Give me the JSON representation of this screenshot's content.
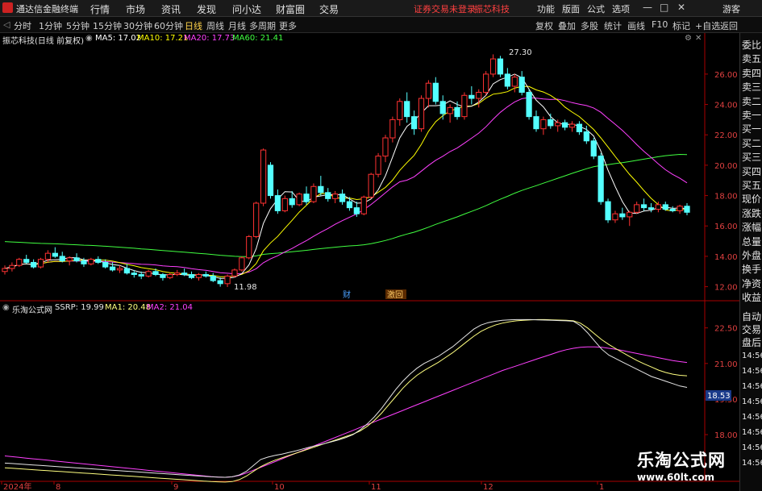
{
  "menubar": {
    "app_title": "通达信金融终端",
    "menus": [
      "行情",
      "市场",
      "资讯",
      "发现",
      "问小达",
      "财富圈",
      "交易"
    ],
    "notice": "证券交易未登录",
    "stock_name": "振芯科技",
    "right_menus": [
      "功能",
      "版面",
      "公式",
      "选项"
    ],
    "user": "游客",
    "controls": [
      "—",
      "□",
      "✕"
    ]
  },
  "toolbar": {
    "periods": [
      "分时",
      "1分钟",
      "5分钟",
      "15分钟",
      "30分钟",
      "60分钟",
      "日线",
      "周线",
      "月线",
      "多周期",
      "更多"
    ],
    "active": "日线",
    "right_items": [
      "复权",
      "叠加",
      "多股",
      "统计",
      "画线",
      "F10",
      "标记",
      "+自选",
      "返回"
    ]
  },
  "main_header": {
    "title": "振芯科技(日线 前复权)",
    "ma5": "MA5: 17.02",
    "ma10": "MA10: 17.21",
    "ma20": "MA20: 17.73",
    "ma60": "MA60: 21.41",
    "colors": {
      "ma5": "#ffffff",
      "ma10": "#ffff00",
      "ma20": "#ff40ff",
      "ma60": "#40ff40"
    }
  },
  "indicator_header": {
    "title": "乐淘公式网",
    "ssrp": "SSRP: 19.99",
    "ma1": "MA1: 20.48",
    "ma2": "MA2: 21.04"
  },
  "price_axis": [
    "26.00",
    "24.00",
    "22.00",
    "20.00",
    "18.00",
    "16.00",
    "14.00",
    "12.00"
  ],
  "indicator_axis": [
    "22.50",
    "21.00",
    "19.50",
    "18.00"
  ],
  "indicator_readout": "18.53",
  "annotations": {
    "high": "27.30",
    "low": "11.98",
    "tag_cai": "财",
    "tag_jihui": "激回"
  },
  "time_axis": [
    "2024年",
    "8",
    "9",
    "10",
    "11",
    "12",
    "1"
  ],
  "right_panel": {
    "top_labels": [
      "委比",
      "卖五",
      "卖四",
      "卖三",
      "卖二",
      "卖一",
      "买一",
      "买二",
      "买三",
      "买四",
      "买五",
      "现价",
      "涨跌",
      "涨幅",
      "总量",
      "外盘",
      "换手",
      "净资",
      "收益"
    ],
    "bottom_labels": [
      "自动",
      "交易",
      "盘后"
    ],
    "times": [
      "14:56",
      "14:56",
      "14:56",
      "14:56",
      "14:56",
      "14:56",
      "14:56",
      "14:56"
    ]
  },
  "watermark": {
    "line1": "乐淘公式网",
    "line2": "www.60lt.com"
  },
  "chart_data": {
    "type": "line",
    "title": "振芯科技(日线 前复权)",
    "ylim": [
      11.5,
      27.8
    ],
    "candles": [
      {
        "o": 13.0,
        "h": 13.4,
        "l": 12.8,
        "c": 13.2
      },
      {
        "o": 13.2,
        "h": 13.6,
        "l": 13.0,
        "c": 13.4
      },
      {
        "o": 13.4,
        "h": 13.9,
        "l": 13.3,
        "c": 13.8
      },
      {
        "o": 13.8,
        "h": 14.1,
        "l": 13.5,
        "c": 13.6
      },
      {
        "o": 13.6,
        "h": 13.8,
        "l": 13.2,
        "c": 13.3
      },
      {
        "o": 13.3,
        "h": 13.9,
        "l": 13.2,
        "c": 13.8
      },
      {
        "o": 13.8,
        "h": 14.4,
        "l": 13.6,
        "c": 14.2
      },
      {
        "o": 14.2,
        "h": 14.6,
        "l": 13.9,
        "c": 14.0
      },
      {
        "o": 14.0,
        "h": 14.3,
        "l": 13.6,
        "c": 13.7
      },
      {
        "o": 13.7,
        "h": 14.0,
        "l": 13.4,
        "c": 13.9
      },
      {
        "o": 13.9,
        "h": 14.2,
        "l": 13.6,
        "c": 13.7
      },
      {
        "o": 13.7,
        "h": 13.9,
        "l": 13.3,
        "c": 13.5
      },
      {
        "o": 13.5,
        "h": 13.9,
        "l": 13.4,
        "c": 13.8
      },
      {
        "o": 13.8,
        "h": 14.0,
        "l": 13.5,
        "c": 13.6
      },
      {
        "o": 13.6,
        "h": 13.8,
        "l": 13.2,
        "c": 13.3
      },
      {
        "o": 13.3,
        "h": 13.6,
        "l": 13.0,
        "c": 13.1
      },
      {
        "o": 13.1,
        "h": 13.4,
        "l": 12.9,
        "c": 13.2
      },
      {
        "o": 13.2,
        "h": 13.5,
        "l": 12.8,
        "c": 12.9
      },
      {
        "o": 12.9,
        "h": 13.1,
        "l": 12.6,
        "c": 12.8
      },
      {
        "o": 12.8,
        "h": 13.0,
        "l": 12.5,
        "c": 12.7
      },
      {
        "o": 12.7,
        "h": 13.1,
        "l": 12.6,
        "c": 13.0
      },
      {
        "o": 13.0,
        "h": 13.2,
        "l": 12.7,
        "c": 12.8
      },
      {
        "o": 12.8,
        "h": 12.9,
        "l": 12.4,
        "c": 12.6
      },
      {
        "o": 12.6,
        "h": 12.9,
        "l": 12.5,
        "c": 12.8
      },
      {
        "o": 12.8,
        "h": 13.1,
        "l": 12.7,
        "c": 12.9
      },
      {
        "o": 12.9,
        "h": 13.2,
        "l": 12.7,
        "c": 12.8
      },
      {
        "o": 12.8,
        "h": 13.0,
        "l": 12.5,
        "c": 12.6
      },
      {
        "o": 12.6,
        "h": 12.9,
        "l": 12.4,
        "c": 12.8
      },
      {
        "o": 12.8,
        "h": 13.0,
        "l": 12.6,
        "c": 12.7
      },
      {
        "o": 12.7,
        "h": 12.9,
        "l": 12.3,
        "c": 12.4
      },
      {
        "o": 12.4,
        "h": 12.6,
        "l": 12.0,
        "c": 12.2
      },
      {
        "o": 12.2,
        "h": 12.8,
        "l": 11.98,
        "c": 12.7
      },
      {
        "o": 12.7,
        "h": 13.2,
        "l": 12.6,
        "c": 13.1
      },
      {
        "o": 13.1,
        "h": 14.0,
        "l": 13.0,
        "c": 13.9
      },
      {
        "o": 13.9,
        "h": 15.4,
        "l": 13.8,
        "c": 15.3
      },
      {
        "o": 15.3,
        "h": 17.6,
        "l": 15.2,
        "c": 17.5
      },
      {
        "o": 17.5,
        "h": 21.1,
        "l": 17.3,
        "c": 21.0
      },
      {
        "o": 20.0,
        "h": 20.2,
        "l": 17.8,
        "c": 18.0
      },
      {
        "o": 18.0,
        "h": 18.4,
        "l": 16.8,
        "c": 17.0
      },
      {
        "o": 17.0,
        "h": 18.0,
        "l": 16.9,
        "c": 17.8
      },
      {
        "o": 17.8,
        "h": 18.3,
        "l": 17.2,
        "c": 17.4
      },
      {
        "o": 17.4,
        "h": 18.2,
        "l": 17.3,
        "c": 18.1
      },
      {
        "o": 18.1,
        "h": 18.6,
        "l": 17.4,
        "c": 17.6
      },
      {
        "o": 17.6,
        "h": 18.8,
        "l": 17.5,
        "c": 18.6
      },
      {
        "o": 18.6,
        "h": 19.3,
        "l": 18.0,
        "c": 18.2
      },
      {
        "o": 18.2,
        "h": 18.5,
        "l": 17.6,
        "c": 17.8
      },
      {
        "o": 17.8,
        "h": 18.3,
        "l": 17.5,
        "c": 18.1
      },
      {
        "o": 18.1,
        "h": 18.4,
        "l": 17.4,
        "c": 17.6
      },
      {
        "o": 17.6,
        "h": 17.9,
        "l": 17.0,
        "c": 17.2
      },
      {
        "o": 17.2,
        "h": 17.6,
        "l": 16.6,
        "c": 16.8
      },
      {
        "o": 16.8,
        "h": 18.0,
        "l": 16.7,
        "c": 17.9
      },
      {
        "o": 17.9,
        "h": 19.5,
        "l": 17.8,
        "c": 19.4
      },
      {
        "o": 19.4,
        "h": 20.8,
        "l": 19.2,
        "c": 20.6
      },
      {
        "o": 20.6,
        "h": 22.0,
        "l": 20.2,
        "c": 21.8
      },
      {
        "o": 21.8,
        "h": 23.2,
        "l": 21.5,
        "c": 23.0
      },
      {
        "o": 23.0,
        "h": 24.4,
        "l": 22.6,
        "c": 24.2
      },
      {
        "o": 24.2,
        "h": 24.8,
        "l": 22.8,
        "c": 23.2
      },
      {
        "o": 23.2,
        "h": 23.6,
        "l": 22.0,
        "c": 22.4
      },
      {
        "o": 22.4,
        "h": 24.6,
        "l": 22.2,
        "c": 24.4
      },
      {
        "o": 24.4,
        "h": 25.6,
        "l": 23.8,
        "c": 25.4
      },
      {
        "o": 25.4,
        "h": 25.8,
        "l": 24.0,
        "c": 24.2
      },
      {
        "o": 24.2,
        "h": 24.6,
        "l": 23.0,
        "c": 23.4
      },
      {
        "o": 23.4,
        "h": 24.0,
        "l": 22.8,
        "c": 23.8
      },
      {
        "o": 23.8,
        "h": 24.2,
        "l": 23.0,
        "c": 23.2
      },
      {
        "o": 23.2,
        "h": 24.8,
        "l": 23.0,
        "c": 24.6
      },
      {
        "o": 24.6,
        "h": 25.2,
        "l": 24.0,
        "c": 24.4
      },
      {
        "o": 24.4,
        "h": 25.0,
        "l": 23.8,
        "c": 24.8
      },
      {
        "o": 24.8,
        "h": 26.2,
        "l": 24.6,
        "c": 26.0
      },
      {
        "o": 26.0,
        "h": 27.3,
        "l": 25.8,
        "c": 27.0
      },
      {
        "o": 27.0,
        "h": 27.2,
        "l": 25.8,
        "c": 26.0
      },
      {
        "o": 26.0,
        "h": 26.4,
        "l": 25.0,
        "c": 25.2
      },
      {
        "o": 25.2,
        "h": 26.0,
        "l": 24.8,
        "c": 25.8
      },
      {
        "o": 25.8,
        "h": 26.2,
        "l": 24.6,
        "c": 24.8
      },
      {
        "o": 24.8,
        "h": 25.0,
        "l": 23.0,
        "c": 23.2
      },
      {
        "o": 23.2,
        "h": 23.6,
        "l": 22.2,
        "c": 22.4
      },
      {
        "o": 22.4,
        "h": 23.2,
        "l": 22.0,
        "c": 23.0
      },
      {
        "o": 23.0,
        "h": 23.4,
        "l": 22.4,
        "c": 22.6
      },
      {
        "o": 22.6,
        "h": 23.0,
        "l": 22.2,
        "c": 22.8
      },
      {
        "o": 22.8,
        "h": 23.0,
        "l": 22.3,
        "c": 22.5
      },
      {
        "o": 22.5,
        "h": 22.9,
        "l": 22.2,
        "c": 22.7
      },
      {
        "o": 22.7,
        "h": 22.9,
        "l": 22.0,
        "c": 22.2
      },
      {
        "o": 22.2,
        "h": 22.6,
        "l": 21.4,
        "c": 21.6
      },
      {
        "o": 21.6,
        "h": 21.8,
        "l": 20.4,
        "c": 20.6
      },
      {
        "o": 20.6,
        "h": 20.8,
        "l": 17.4,
        "c": 17.6
      },
      {
        "o": 17.6,
        "h": 17.8,
        "l": 16.2,
        "c": 16.4
      },
      {
        "o": 16.4,
        "h": 17.0,
        "l": 16.2,
        "c": 16.8
      },
      {
        "o": 16.8,
        "h": 17.2,
        "l": 16.4,
        "c": 16.6
      },
      {
        "o": 16.6,
        "h": 17.0,
        "l": 16.0,
        "c": 16.9
      },
      {
        "o": 16.9,
        "h": 17.6,
        "l": 16.8,
        "c": 17.4
      },
      {
        "o": 17.4,
        "h": 17.8,
        "l": 17.0,
        "c": 17.2
      },
      {
        "o": 17.2,
        "h": 17.5,
        "l": 16.9,
        "c": 17.1
      },
      {
        "o": 17.1,
        "h": 17.6,
        "l": 16.9,
        "c": 17.4
      },
      {
        "o": 17.4,
        "h": 17.6,
        "l": 17.0,
        "c": 17.1
      },
      {
        "o": 17.1,
        "h": 17.3,
        "l": 16.9,
        "c": 17.0
      },
      {
        "o": 17.0,
        "h": 17.4,
        "l": 16.8,
        "c": 17.3
      },
      {
        "o": 17.3,
        "h": 17.5,
        "l": 16.7,
        "c": 16.9
      }
    ],
    "ma60_start": 15.0,
    "indicator": {
      "ylim": [
        16.2,
        23.0
      ],
      "ssrp": [
        16.8,
        16.78,
        16.76,
        16.74,
        16.72,
        16.7,
        16.68,
        16.66,
        16.64,
        16.62,
        16.6,
        16.58,
        16.56,
        16.54,
        16.52,
        16.5,
        16.48,
        16.46,
        16.44,
        16.42,
        16.4,
        16.38,
        16.36,
        16.34,
        16.32,
        16.3,
        16.28,
        16.26,
        16.24,
        16.22,
        16.21,
        16.2,
        16.22,
        16.3,
        16.45,
        16.7,
        16.95,
        17.05,
        17.12,
        17.18,
        17.25,
        17.32,
        17.4,
        17.48,
        17.55,
        17.62,
        17.7,
        17.78,
        17.88,
        18.0,
        18.2,
        18.45,
        18.75,
        19.1,
        19.5,
        19.9,
        20.25,
        20.55,
        20.8,
        21.0,
        21.15,
        21.3,
        21.5,
        21.7,
        21.95,
        22.2,
        22.45,
        22.62,
        22.72,
        22.78,
        22.82,
        22.84,
        22.85,
        22.85,
        22.85,
        22.84,
        22.83,
        22.82,
        22.81,
        22.8,
        22.78,
        22.6,
        22.3,
        21.95,
        21.6,
        21.35,
        21.2,
        21.05,
        20.9,
        20.75,
        20.6,
        20.45,
        20.35,
        20.25,
        20.15,
        20.05,
        19.99
      ],
      "ma1": [
        16.6,
        16.58,
        16.56,
        16.54,
        16.52,
        16.5,
        16.48,
        16.46,
        16.44,
        16.42,
        16.4,
        16.38,
        16.36,
        16.34,
        16.32,
        16.3,
        16.28,
        16.26,
        16.24,
        16.22,
        16.2,
        16.18,
        16.16,
        16.14,
        16.12,
        16.1,
        16.08,
        16.06,
        16.04,
        16.02,
        16.01,
        16.0,
        16.02,
        16.1,
        16.25,
        16.45,
        16.65,
        16.8,
        16.92,
        17.02,
        17.12,
        17.22,
        17.32,
        17.42,
        17.52,
        17.62,
        17.72,
        17.82,
        17.92,
        18.02,
        18.15,
        18.35,
        18.6,
        18.9,
        19.25,
        19.6,
        19.95,
        20.25,
        20.5,
        20.7,
        20.88,
        21.05,
        21.25,
        21.45,
        21.68,
        21.92,
        22.15,
        22.35,
        22.5,
        22.62,
        22.7,
        22.76,
        22.8,
        22.82,
        22.84,
        22.85,
        22.85,
        22.84,
        22.83,
        22.82,
        22.8,
        22.7,
        22.5,
        22.25,
        22.0,
        21.8,
        21.62,
        21.45,
        21.28,
        21.12,
        20.98,
        20.85,
        20.72,
        20.62,
        20.55,
        20.5,
        20.48
      ],
      "ma2": [
        17.1,
        17.07,
        17.04,
        17.01,
        16.98,
        16.95,
        16.92,
        16.89,
        16.86,
        16.83,
        16.8,
        16.77,
        16.74,
        16.71,
        16.68,
        16.65,
        16.62,
        16.59,
        16.56,
        16.53,
        16.5,
        16.47,
        16.44,
        16.41,
        16.38,
        16.35,
        16.32,
        16.29,
        16.26,
        16.23,
        16.21,
        16.2,
        16.22,
        16.28,
        16.38,
        16.5,
        16.62,
        16.74,
        16.86,
        16.98,
        17.1,
        17.22,
        17.34,
        17.46,
        17.58,
        17.7,
        17.82,
        17.94,
        18.06,
        18.18,
        18.3,
        18.42,
        18.54,
        18.66,
        18.78,
        18.9,
        19.02,
        19.14,
        19.26,
        19.38,
        19.5,
        19.62,
        19.74,
        19.86,
        19.98,
        20.1,
        20.22,
        20.34,
        20.46,
        20.58,
        20.7,
        20.8,
        20.9,
        21.0,
        21.1,
        21.2,
        21.3,
        21.4,
        21.5,
        21.58,
        21.64,
        21.68,
        21.7,
        21.7,
        21.68,
        21.64,
        21.6,
        21.54,
        21.48,
        21.42,
        21.36,
        21.3,
        21.24,
        21.18,
        21.12,
        21.08,
        21.04
      ]
    }
  }
}
